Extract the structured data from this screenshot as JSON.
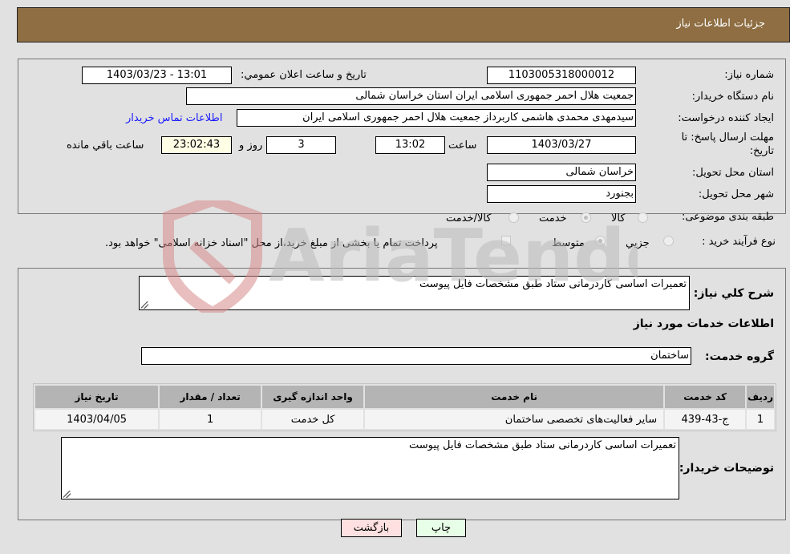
{
  "header": {
    "title": "جزئیات اطلاعات نیاز"
  },
  "details": {
    "need_number_label": "شماره نیاز:",
    "need_number": "1103005318000012",
    "announce_label": "تاریخ و ساعت اعلان عمومي:",
    "announce_value": "1403/03/23 - 13:01",
    "buyer_org_label": "نام دستگاه خریدار:",
    "buyer_org": "جمعیت هلال احمر جمهوری اسلامی ایران استان خراسان شمالی",
    "creator_label": "ایجاد کننده درخواست:",
    "creator": "سیدمهدی محمدی هاشمی کاربرداز جمعیت هلال احمر جمهوری اسلامی ایران",
    "contact_link": "اطلاعات تماس خریدار",
    "deadline_label_1": "مهلت ارسال پاسخ: تا",
    "deadline_label_2": "تاریخ:",
    "deadline_date": "1403/03/27",
    "time_label": "ساعت",
    "deadline_time": "13:02",
    "days_value": "3",
    "days_label": "روز و",
    "remaining_time": "23:02:43",
    "remaining_label": "ساعت باقي مانده",
    "province_label": "استان محل تحویل:",
    "province": "خراسان شمالی",
    "city_label": "شهر محل تحویل:",
    "city": "بجنورد",
    "category_label": "طبقه بندی موضوعی:",
    "category_options": [
      {
        "label": "کالا",
        "selected": false
      },
      {
        "label": "خدمت",
        "selected": true
      },
      {
        "label": "کالا/خدمت",
        "selected": false
      }
    ],
    "process_label": "نوع فرآیند خرید :",
    "process_options": [
      {
        "label": "جزيي",
        "selected": false
      },
      {
        "label": "متوسط",
        "selected": true
      }
    ],
    "treasury_note": "پرداخت تمام یا بخشی از مبلغ خرید،از محل \"اسناد خزانه اسلامی\" خواهد بود.",
    "treasury_checked": false
  },
  "services": {
    "summary_label": "شرح کلي نیاز:",
    "summary": "تعمیرات اساسی کاردرمانی ستاد طبق مشخصات فایل پیوست",
    "section_title": "اطلاعات خدمات مورد نیاز",
    "group_label": "گروه خدمت:",
    "group_value": "ساختمان",
    "table": {
      "headers": [
        "ردیف",
        "کد خدمت",
        "نام خدمت",
        "واحد اندازه گیری",
        "تعداد / مقدار",
        "تاریخ نیاز"
      ],
      "rows": [
        [
          "1",
          "ج-43-439",
          "سایر فعالیت‌های تخصصی ساختمان",
          "کل خدمت",
          "1",
          "1403/04/05"
        ]
      ]
    },
    "buyer_notes_label": "توضیحات خریدار:",
    "buyer_notes": "تعمیرات اساسی کاردرمانی ستاد طبق مشخصات فایل پیوست"
  },
  "buttons": {
    "print": "چاپ",
    "back": "بازگشت"
  },
  "watermark": {
    "text": "AriaTender.neT"
  },
  "colors": {
    "header_bg": "#8e6e42",
    "page_bg": "#e1e1e1",
    "print_bg": "#e6ffe6",
    "back_bg": "#ffe0e0",
    "link": "#1a1aff"
  }
}
